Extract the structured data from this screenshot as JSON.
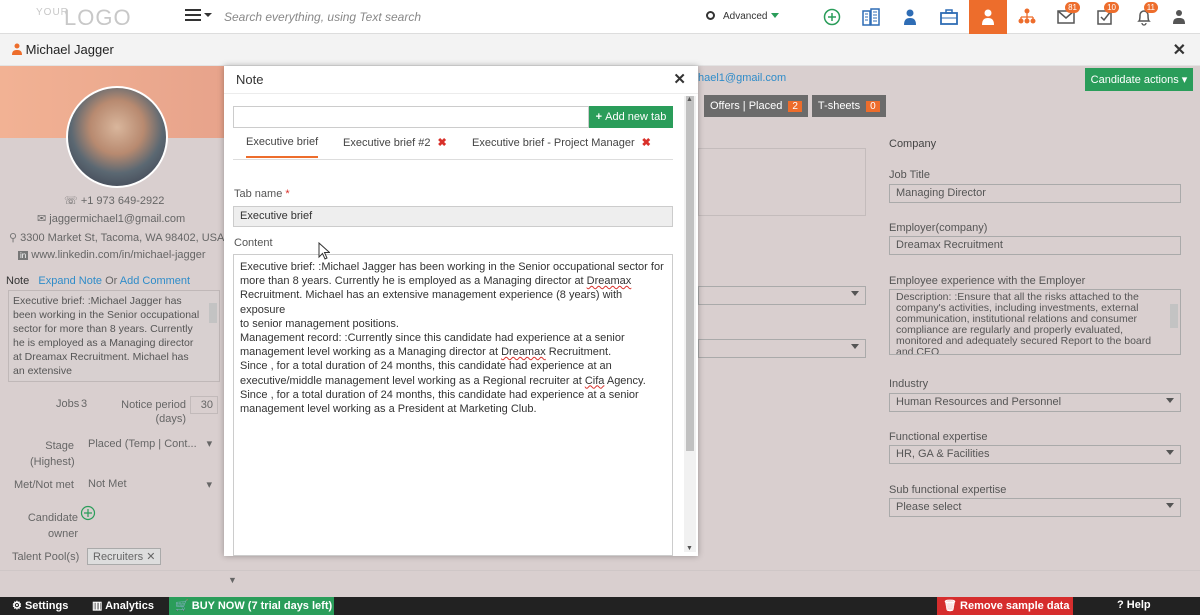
{
  "logo": {
    "your": "YOUR",
    "brand": "LOGO"
  },
  "search": {
    "placeholder": "Search everything, using Text search",
    "advanced": "Advanced"
  },
  "badges": {
    "mail": "81",
    "tasks": "10",
    "bell": "11"
  },
  "colors": {
    "accent": "#ed6d2c",
    "green": "#2a9d5a",
    "red": "#d62d2d",
    "link": "#2f8cc9"
  },
  "header": {
    "name": "Michael Jagger"
  },
  "profile": {
    "phone": "+1 973 649-2922",
    "email": "jaggermichael1@gmail.com",
    "address": "3300 Market St, Tacoma, WA 98402, USA",
    "linkedin": "www.linkedin.com/in/michael-jagger",
    "note_label": "Note",
    "expand_note": "Expand Note",
    "or": "Or",
    "add_comment": "Add Comment",
    "note_text": "Executive brief: :Michael Jagger has been working in the Senior occupational sector for more than 8 years. Currently he is employed as a Managing director at Dreamax Recruitment. Michael has an extensive",
    "jobs_label": "Jobs",
    "jobs_value": "3",
    "notice_label": "Notice period (days)",
    "notice_value": "30",
    "stage_label": "Stage (Highest)",
    "stage_value": "Placed (Temp | Cont...",
    "met_label": "Met/Not met",
    "met_value": "Not Met",
    "owner_label": "Candidate owner",
    "pool_label": "Talent Pool(s)",
    "pool_value": "Recruiters"
  },
  "modal": {
    "title": "Note",
    "add_tab": "Add new tab",
    "tabs": [
      {
        "label": "Executive brief"
      },
      {
        "label": "Executive brief #2"
      },
      {
        "label": "Executive brief - Project Manager"
      }
    ],
    "tab_name_label": "Tab name",
    "tab_name_value": "Executive brief",
    "content_label": "Content",
    "content_lines": [
      "Executive brief: :Michael Jagger has been working in the Senior occupational sector for",
      "more than 8 years. Currently he is employed as a Managing director at Dreamax",
      "Recruitment. Michael has an extensive management experience (8 years) with exposure",
      "to senior management positions.",
      "Management record: :Currently since  this candidate had experience at a senior",
      "management level working as a Managing director at Dreamax Recruitment.",
      "Since , for a total duration of 24 months, this candidate had experience at an",
      "executive/middle management level working as a Regional recruiter at Cifa Agency.",
      "Since , for a total duration of 24 months, this candidate had experience at a senior",
      "management level working as a President at Marketing Club."
    ]
  },
  "right": {
    "email_partial": "hael1@gmail.com",
    "candidate_actions": "Candidate actions",
    "offers_label": "Offers | Placed",
    "offers_count": "2",
    "tsheets_label": "T-sheets",
    "tsheets_count": "0",
    "company_label": "Company",
    "job_title_label": "Job Title",
    "job_title_value": "Managing Director",
    "employer_label": "Employer(company)",
    "employer_value": "Dreamax Recruitment",
    "exp_label": "Employee experience with the Employer",
    "exp_text": "Description: :Ensure that all the risks attached to the company's activities, including investments, external communication, institutional relations and consumer compliance are regularly and properly evaluated, monitored and adequately secured Report to the board and CEO",
    "industry_label": "Industry",
    "industry_value": "Human Resources and Personnel",
    "func_label": "Functional expertise",
    "func_value": "HR, GA & Facilities",
    "subfunc_label": "Sub functional expertise",
    "subfunc_value": "Please select"
  },
  "footer": {
    "settings": "Settings",
    "analytics": "Analytics",
    "buy_now": "BUY NOW (7 trial days left)",
    "remove": "Remove sample data",
    "help": "Help"
  }
}
